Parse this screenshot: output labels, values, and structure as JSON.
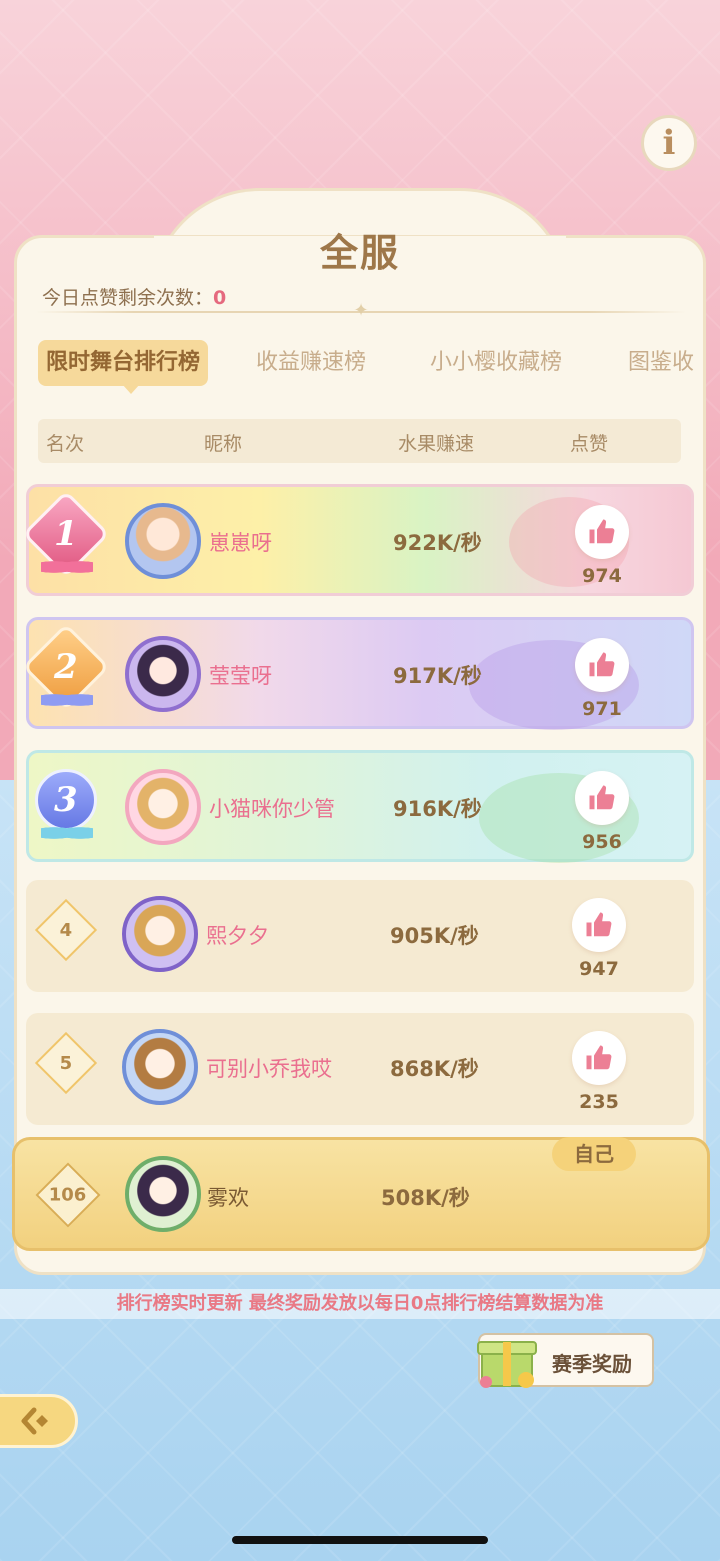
{
  "title": "全服",
  "likes_remaining": {
    "label": "今日点赞剩余次数：",
    "value": "0"
  },
  "tabs": [
    {
      "label": "限时舞台排行榜",
      "active": true
    },
    {
      "label": "收益赚速榜",
      "active": false
    },
    {
      "label": "小小樱收藏榜",
      "active": false
    },
    {
      "label": "图鉴收",
      "active": false
    }
  ],
  "columns": {
    "rank": "名次",
    "nickname": "昵称",
    "speed": "水果赚速",
    "likes": "点赞"
  },
  "rows": [
    {
      "rank": "1",
      "nickname": "崽崽呀",
      "speed": "922K/秒",
      "likes": "974"
    },
    {
      "rank": "2",
      "nickname": "莹莹呀",
      "speed": "917K/秒",
      "likes": "971"
    },
    {
      "rank": "3",
      "nickname": "小猫咪你少管",
      "speed": "916K/秒",
      "likes": "956"
    },
    {
      "rank": "4",
      "nickname": "熙夕夕",
      "speed": "905K/秒",
      "likes": "947"
    },
    {
      "rank": "5",
      "nickname": "可别小乔我哎",
      "speed": "868K/秒",
      "likes": "235"
    }
  ],
  "self_row": {
    "tag": "自己",
    "rank": "106",
    "nickname": "雾欢",
    "speed": "508K/秒"
  },
  "notice": "排行榜实时更新 最终奖励发放以每日0点排行榜结算数据为准",
  "season_reward": {
    "label": "赛季奖励"
  },
  "info_icon": "i",
  "colors": {
    "accent_pink": "#e5697e",
    "tab_active_bg": "#f6d99b",
    "gold": "#f2d17f"
  }
}
